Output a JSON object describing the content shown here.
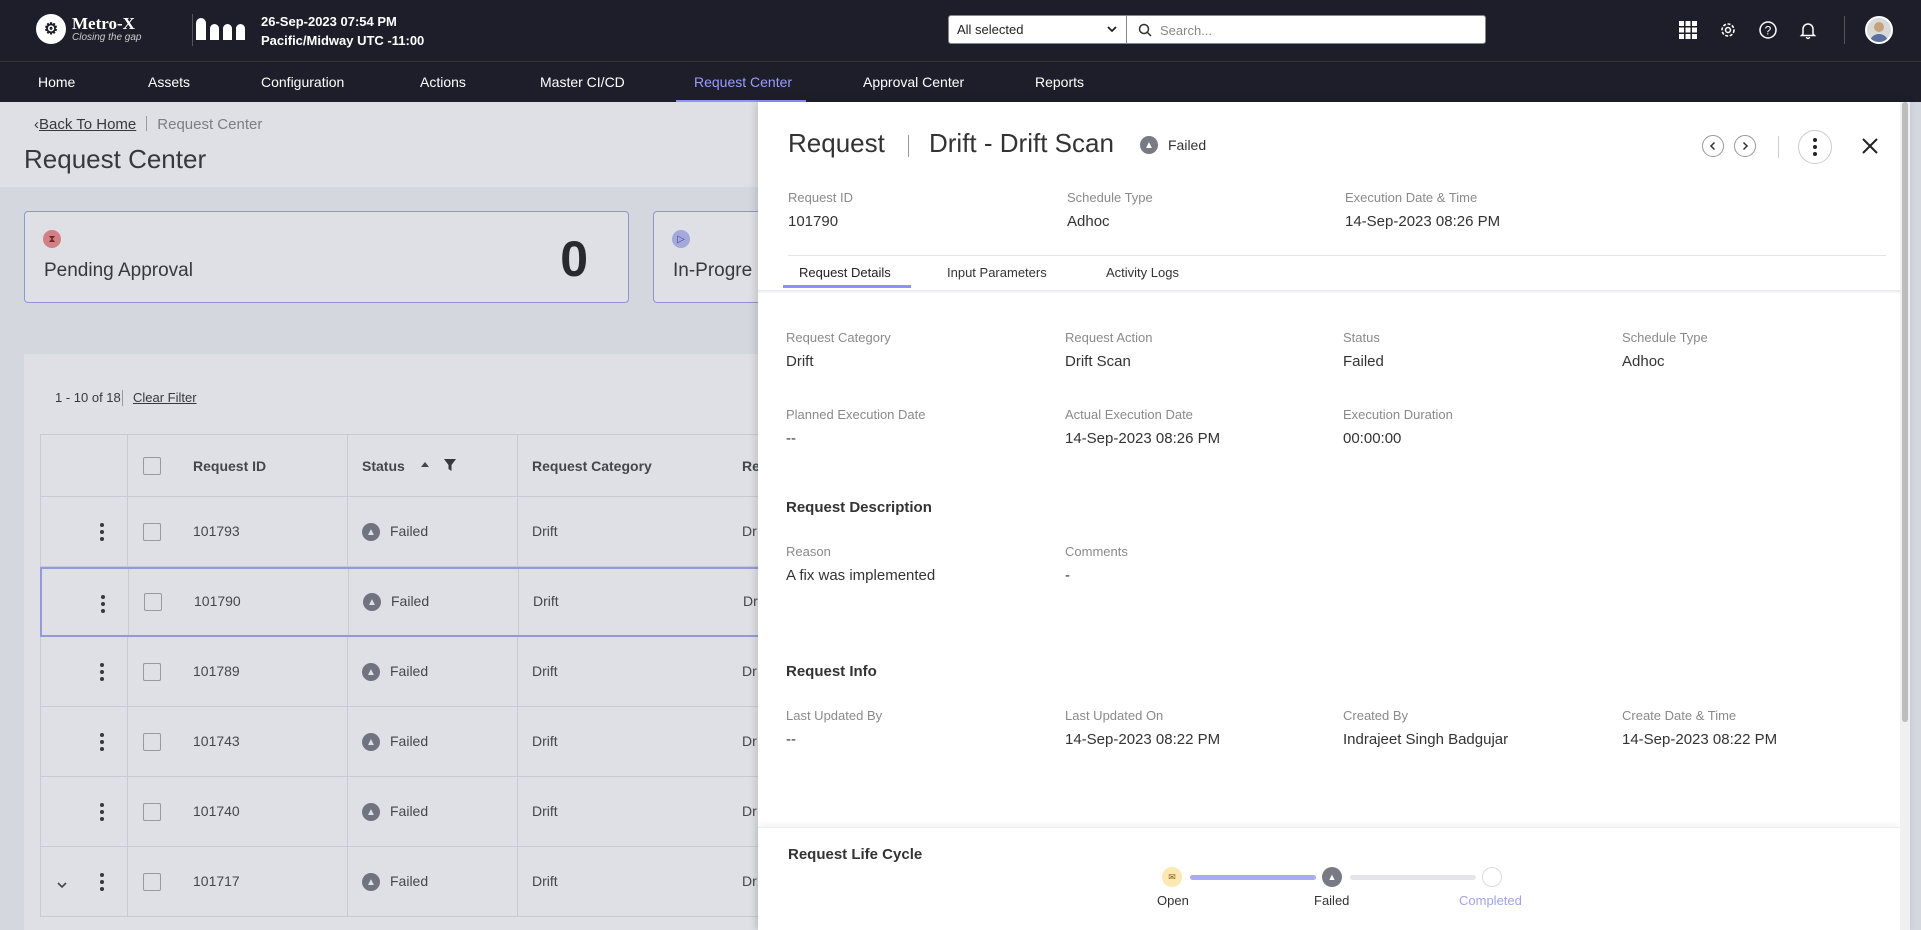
{
  "brand": {
    "name": "Metro-X",
    "tagline": "Closing the gap"
  },
  "clock": {
    "date_time": "26-Sep-2023 07:54 PM",
    "timezone": "Pacific/Midway UTC -11:00"
  },
  "search": {
    "scope_value": "All selected",
    "placeholder": "Search..."
  },
  "nav": {
    "items": [
      {
        "label": "Home"
      },
      {
        "label": "Assets"
      },
      {
        "label": "Configuration"
      },
      {
        "label": "Actions"
      },
      {
        "label": "Master CI/CD"
      },
      {
        "label": "Request Center"
      },
      {
        "label": "Approval Center"
      },
      {
        "label": "Reports"
      }
    ],
    "active": "Request Center"
  },
  "breadcrumb": {
    "back_label": "Back To Home",
    "current": "Request Center"
  },
  "page_title": "Request Center",
  "cards": [
    {
      "label": "Pending Approval",
      "value": "0",
      "icon": "hourglass-icon",
      "color": "#f08a8a"
    },
    {
      "label": "In-Progre",
      "icon": "play-icon",
      "color": "#b9bbf2"
    }
  ],
  "table": {
    "count_text": "1 - 10 of 18",
    "clear_filter": "Clear Filter",
    "headers": {
      "request_id": "Request ID",
      "status": "Status",
      "category": "Request Category",
      "action": "Re"
    },
    "rows": [
      {
        "id": "101793",
        "status": "Failed",
        "category": "Drift",
        "action": "Dr"
      },
      {
        "id": "101790",
        "status": "Failed",
        "category": "Drift",
        "action": "Dr"
      },
      {
        "id": "101789",
        "status": "Failed",
        "category": "Drift",
        "action": "Dr"
      },
      {
        "id": "101743",
        "status": "Failed",
        "category": "Drift",
        "action": "Dr"
      },
      {
        "id": "101740",
        "status": "Failed",
        "category": "Drift",
        "action": "Dr"
      },
      {
        "id": "101717",
        "status": "Failed",
        "category": "Drift",
        "action": "Dr"
      }
    ]
  },
  "panel": {
    "title": "Request",
    "name": "Drift - Drift Scan",
    "status": "Failed",
    "summary": {
      "request_id_label": "Request ID",
      "request_id": "101790",
      "schedule_type_label": "Schedule Type",
      "schedule_type": "Adhoc",
      "exec_label": "Execution Date & Time",
      "exec": "14-Sep-2023 08:26 PM"
    },
    "tabs": [
      {
        "label": "Request Details"
      },
      {
        "label": "Input Parameters"
      },
      {
        "label": "Activity Logs"
      }
    ],
    "details": {
      "category_label": "Request Category",
      "category": "Drift",
      "action_label": "Request Action",
      "action": "Drift Scan",
      "status_label": "Status",
      "status": "Failed",
      "schedule_label": "Schedule Type",
      "schedule": "Adhoc",
      "planned_label": "Planned Execution Date",
      "planned": "--",
      "actual_label": "Actual Execution Date",
      "actual": "14-Sep-2023 08:26 PM",
      "duration_label": "Execution Duration",
      "duration": "00:00:00"
    },
    "description": {
      "title": "Request Description",
      "reason_label": "Reason",
      "reason": "A fix was implemented",
      "comments_label": "Comments",
      "comments": "-"
    },
    "info": {
      "title": "Request Info",
      "updated_by_label": "Last Updated By",
      "updated_by": "--",
      "updated_on_label": "Last Updated On",
      "updated_on": "14-Sep-2023 08:22 PM",
      "created_by_label": "Created By",
      "created_by": "Indrajeet Singh Badgujar",
      "created_at_label": "Create Date & Time",
      "created_at": "14-Sep-2023 08:22 PM"
    },
    "lifecycle": {
      "title": "Request Life Cycle",
      "steps": [
        {
          "label": "Open",
          "state": "done"
        },
        {
          "label": "Failed",
          "state": "current"
        },
        {
          "label": "Completed",
          "state": "pending"
        }
      ]
    }
  },
  "colors": {
    "topbar": "#1e1e2a",
    "accent": "#8f91ff",
    "card_border": "#9fa3e6"
  }
}
